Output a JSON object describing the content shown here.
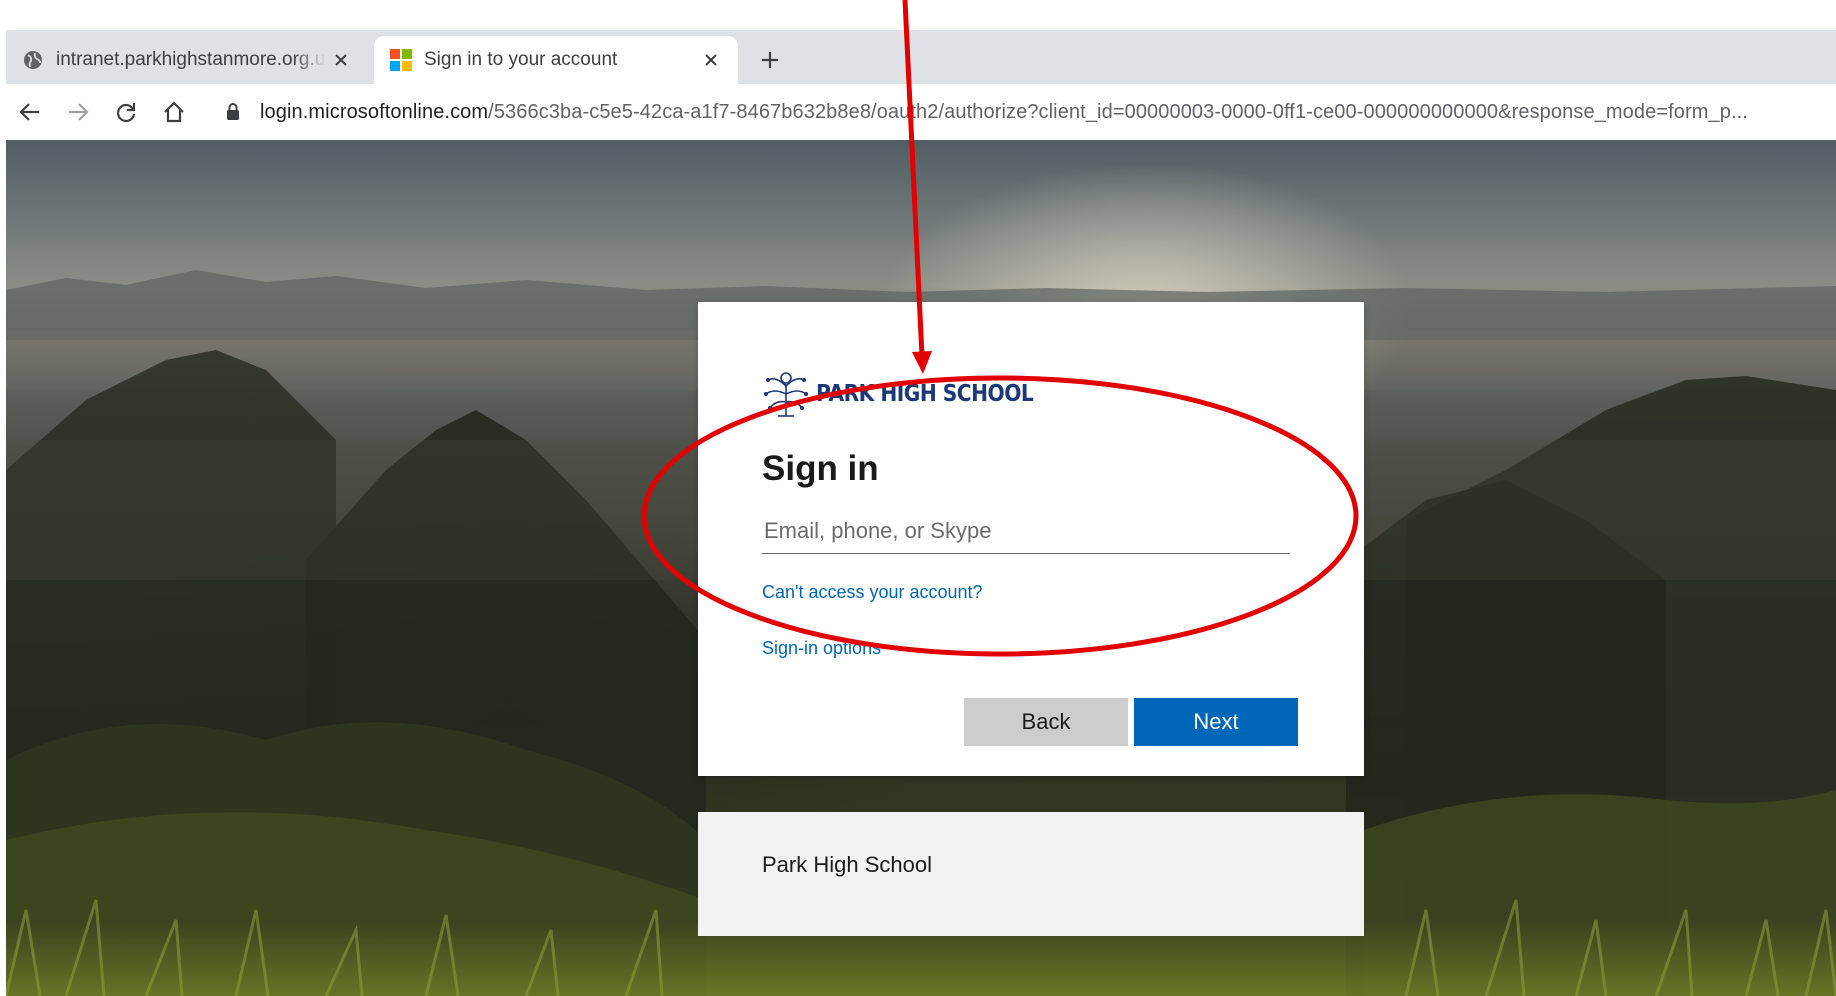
{
  "browser": {
    "tabs": [
      {
        "title": "intranet.parkhighstanmore.org.uk",
        "favicon": "globe-icon",
        "active": false
      },
      {
        "title": "Sign in to your account",
        "favicon": "microsoft-logo-icon",
        "active": true
      }
    ],
    "address_bar": {
      "host": "login.microsoftonline.com",
      "path": "/5366c3ba-c5e5-42ca-a1f7-8467b632b8e8/oauth2/authorize?client_id=00000003-0000-0ff1-ce00-000000000000&response_mode=form_p..."
    }
  },
  "signin": {
    "logo_text": "PARK HIGH SCHOOL",
    "heading": "Sign in",
    "email_placeholder": "Email, phone, or Skype",
    "cant_access": "Can't access your account?",
    "signin_options": "Sign-in options",
    "back": "Back",
    "next": "Next",
    "footer": "Park High School"
  },
  "colors": {
    "brand_blue": "#0067b8",
    "annotation_red": "#e30000",
    "back_button_gray": "#cccccc",
    "footer_gray": "#f2f2f2"
  }
}
